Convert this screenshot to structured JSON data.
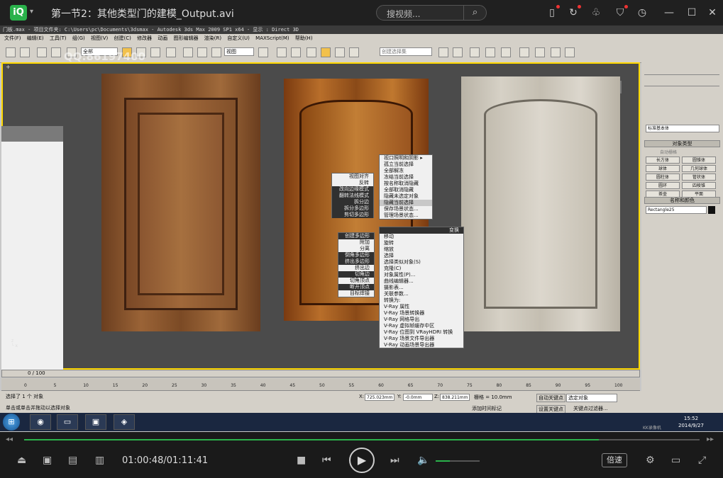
{
  "player": {
    "logo": "iQ",
    "title": "第一节2：其他类型门的建模_Output.avi",
    "search_placeholder": "搜视频...",
    "current_time": "01:00:48/01:11:41",
    "speed_label": "倍速",
    "progress": 0.851,
    "volume": 0.33
  },
  "max": {
    "title_bar": "门板.max    - 项目文件夹: C:\\Users\\pc\\Documents\\3dsmax    - Autodesk 3ds Max  2009 SP1  x64    - 显示 : Direct 3D",
    "menu": [
      "文件(F)",
      "编辑(E)",
      "工具(T)",
      "组(G)",
      "视图(V)",
      "创建(C)",
      "修改器",
      "动画",
      "图形编辑器",
      "渲染(R)",
      "自定义(U)",
      "MAXScript(M)",
      "帮助(H)"
    ],
    "toolbar_select_filter": "全部",
    "toolbar_view_dropdown": "视图",
    "toolbar_selection_set": "创建选择集",
    "watermark": "QQ:86197400",
    "viewport_label": "+",
    "quad_top": [
      "视口照明和阴影 ▸",
      "孤立当前选择",
      "全部解冻",
      "冻结当前选择",
      "按名称取消隐藏",
      "全部取消隐藏",
      "隐藏未选定对象",
      "隐藏当前选择",
      "保存场景状态...",
      "管理场景状态..."
    ],
    "quad_left_top": [
      "视图对齐",
      "反转",
      "改向边缘模式",
      "翻转法线模式",
      "拆分边",
      "拆分多边形",
      "剪切多边形"
    ],
    "quad_left_bottom": [
      "创建多边形",
      "附加",
      "分离",
      "倒角多边形",
      "挤出多边形",
      "挤出边",
      "切角边",
      "切角顶点",
      "断开顶点",
      "目标焊接"
    ],
    "quad_right_header": "变换",
    "quad_right": [
      "移动",
      "旋转",
      "缩放",
      "选择",
      "选择类似对象(S)",
      "克隆(C)",
      "对象属性(P)...",
      "曲线编辑器...",
      "摄影表...",
      "关联参数...",
      "转换为:",
      "V-Ray 属性",
      "V-Ray 场景转换器",
      "V-Ray 网格导出",
      "V-Ray 虚拟帧缓存中区",
      "V-Ray 位图到 VRayHDRI 转换",
      "V-Ray 场景文件导出器",
      "V-Ray 动画场景导出器"
    ],
    "cmd_dropdown": "标准基本体",
    "cmd_object_type": "对象类型",
    "cmd_autogrid": "自动栅格",
    "cmd_buttons": [
      "长方体",
      "圆锥体",
      "球体",
      "几何球体",
      "圆柱体",
      "管状体",
      "圆环",
      "四棱锥",
      "茶壶",
      "平面"
    ],
    "cmd_name_color": "名称和颜色",
    "cmd_object_name": "Rectangle25",
    "time_slider": "0 / 100",
    "ruler_ticks": [
      "0",
      "5",
      "10",
      "15",
      "20",
      "25",
      "30",
      "35",
      "40",
      "45",
      "50",
      "55",
      "60",
      "65",
      "70",
      "75",
      "80",
      "85",
      "90",
      "95",
      "100"
    ],
    "status_selected": "选择了 1 个 对象",
    "status_prompt": "单击或单击并拖动以选择对象",
    "coord_x_label": "X:",
    "coord_x": "725.023mm",
    "coord_y_label": "Y:",
    "coord_y": "-0.0mm",
    "coord_z_label": "Z:",
    "coord_z": "838.211mm",
    "grid": "栅格 = 10.0mm",
    "add_time_tag": "添加时间标记",
    "auto_key": "自动关键点",
    "set_key": "设置关键点",
    "selected_obj": "选定对象",
    "key_filter": "关键点过滤器...",
    "tray_text": "KK录像机"
  },
  "taskbar": {
    "clock_time": "15:52",
    "clock_date": "2014/9/27"
  }
}
